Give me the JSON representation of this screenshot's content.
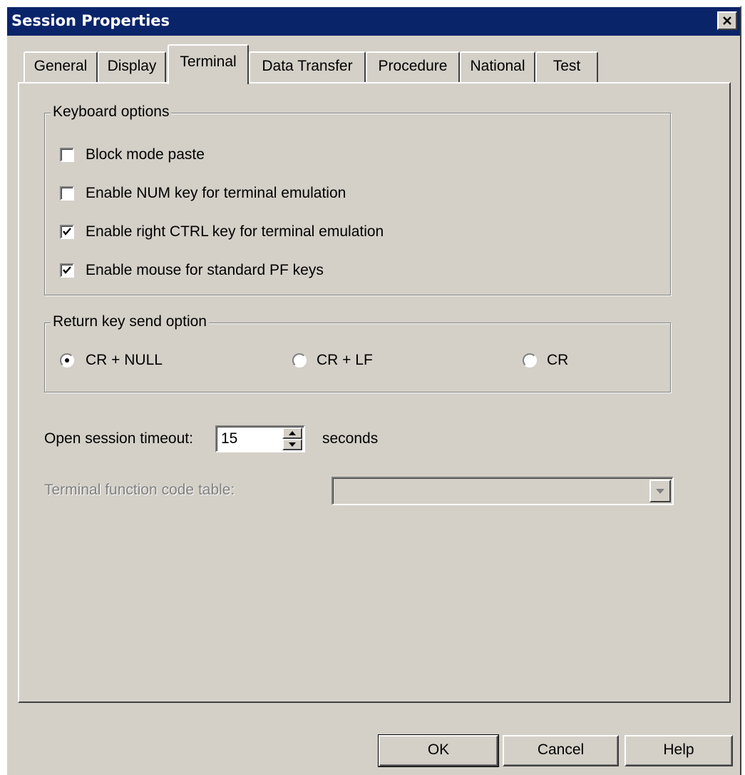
{
  "window": {
    "title": "Session Properties"
  },
  "tabs": [
    {
      "label": "General",
      "active": false
    },
    {
      "label": "Display",
      "active": false
    },
    {
      "label": "Terminal",
      "active": true
    },
    {
      "label": "Data Transfer",
      "active": false
    },
    {
      "label": "Procedure",
      "active": false
    },
    {
      "label": "National",
      "active": false
    },
    {
      "label": "Test",
      "active": false
    }
  ],
  "keyboard_options": {
    "legend": "Keyboard options",
    "items": [
      {
        "label": "Block mode paste",
        "checked": false
      },
      {
        "label": "Enable NUM key for terminal emulation",
        "checked": false
      },
      {
        "label": "Enable right CTRL key for terminal emulation",
        "checked": true
      },
      {
        "label": "Enable mouse for standard PF keys",
        "checked": true
      }
    ]
  },
  "return_key": {
    "legend": "Return key send option",
    "options": [
      {
        "label": "CR + NULL",
        "selected": true
      },
      {
        "label": "CR + LF",
        "selected": false
      },
      {
        "label": "CR",
        "selected": false
      }
    ]
  },
  "timeout": {
    "label": "Open session timeout:",
    "value": "15",
    "unit": "seconds"
  },
  "function_code_table": {
    "label": "Terminal function code table:",
    "value": "",
    "enabled": false
  },
  "buttons": {
    "ok": "OK",
    "cancel": "Cancel",
    "help": "Help"
  },
  "colors": {
    "title_bar": "#0a246a",
    "face": "#d4d0c8"
  }
}
